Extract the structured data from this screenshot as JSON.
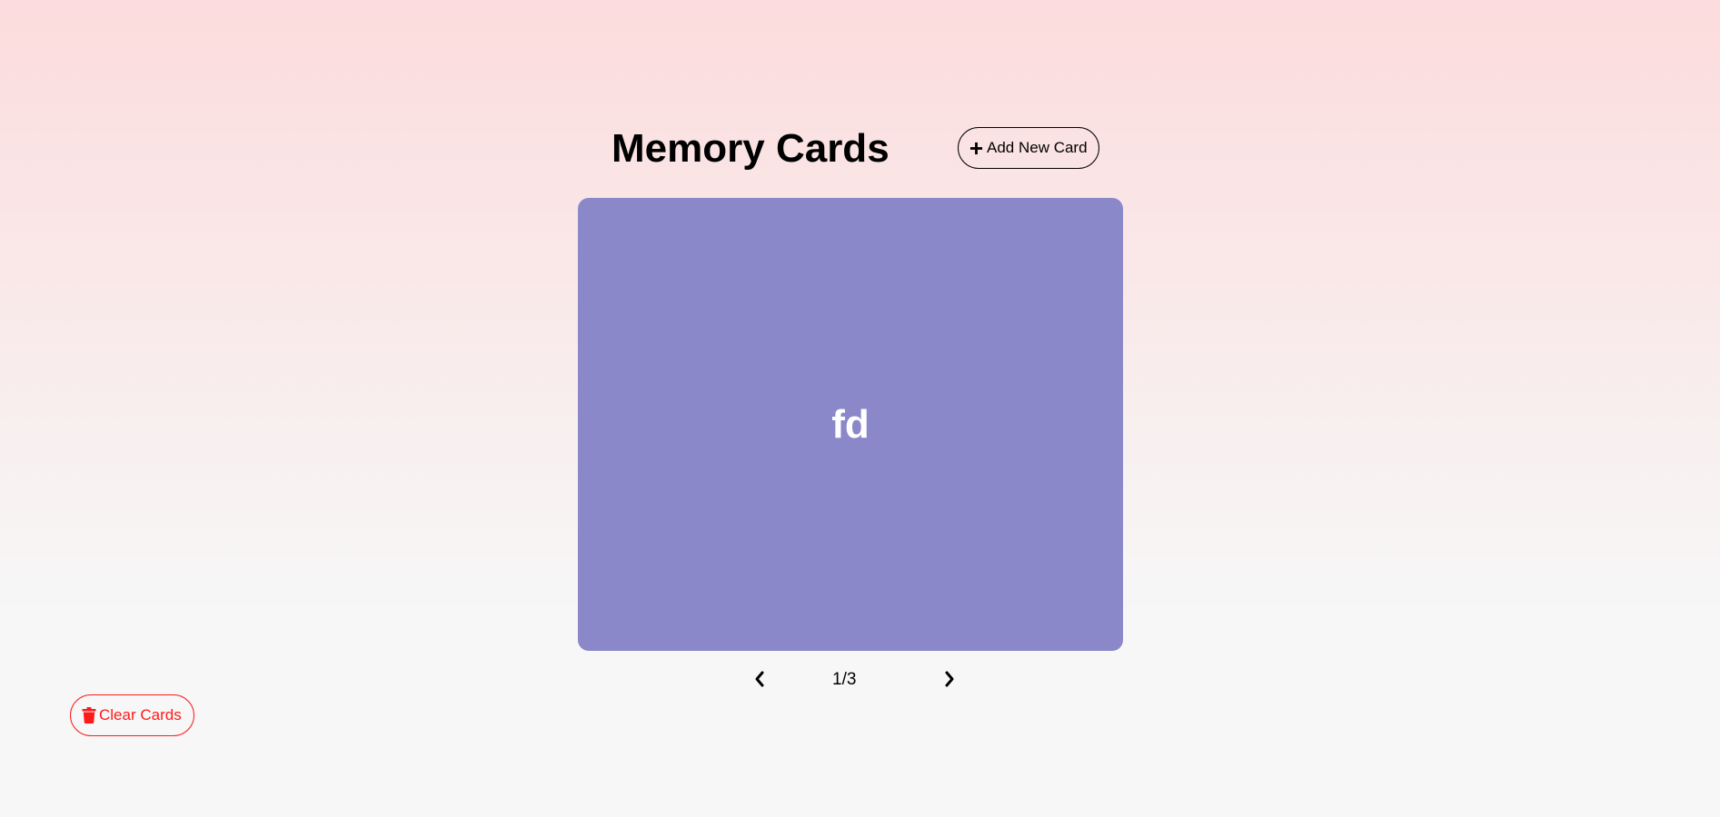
{
  "header": {
    "title": "Memory Cards",
    "add_button_label": "Add New Card",
    "add_button_icon": "plus-icon"
  },
  "card": {
    "text": "fd",
    "background_color": "#8a88c9"
  },
  "navigation": {
    "prev_icon": "chevron-left-icon",
    "next_icon": "chevron-right-icon",
    "counter": "1/3"
  },
  "clear_button": {
    "label": "Clear Cards",
    "icon": "trash-icon",
    "color": "#ff1a1a"
  }
}
